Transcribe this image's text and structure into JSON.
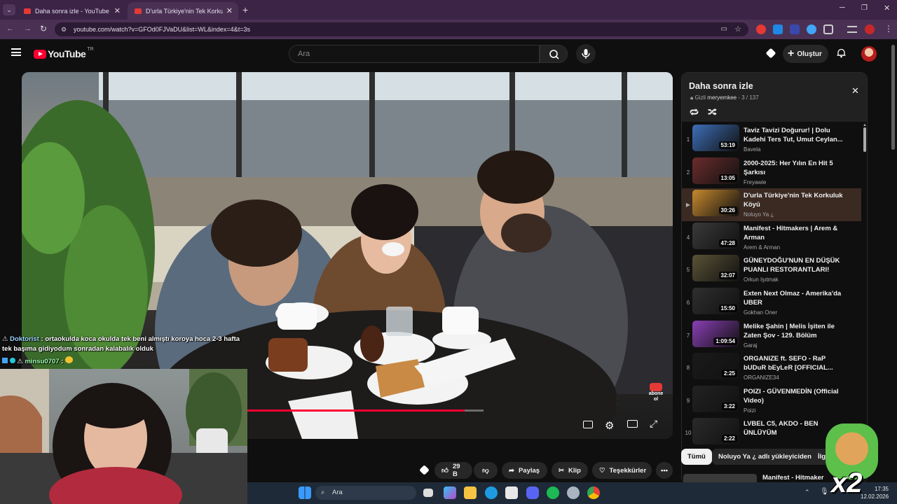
{
  "browser": {
    "tabs": [
      {
        "title": "Daha sonra izle - YouTube",
        "active": false
      },
      {
        "title": "D'urla Türkiye'nin Tek Korkuluk",
        "active": true
      }
    ],
    "url": "youtube.com/watch?v=GFOd0FJVaDU&list=WL&index=4&t=3s"
  },
  "header": {
    "logo_text": "YouTube",
    "logo_sup": "TR",
    "search_placeholder": "Ara",
    "create_label": "Oluştur"
  },
  "video": {
    "watermark": "abone ol",
    "progress_fraction": 0.92
  },
  "chat": {
    "messages": [
      {
        "user": "Doktorist",
        "text": ": ortaokulda koca okulda tek beni almıştı koroya hoca 2-3 hafta tek başıma gidiyodum sonradan kalabalık olduk"
      },
      {
        "user": "minsu0707",
        "text": ":"
      }
    ]
  },
  "actions": {
    "likes": "29 B",
    "share": "Paylaş",
    "clip": "Klip",
    "thanks": "Teşekkürler"
  },
  "playlist": {
    "title": "Daha sonra izle",
    "privacy": "Gizli",
    "owner": "meryemkee",
    "position": "3 / 137",
    "items": [
      {
        "index": "1",
        "title": "Taviz Tavizi Doğurur! | Dolu Kadehi Ters Tut, Umut Ceylan...",
        "channel": "Bavela",
        "duration": "53:19",
        "color": "#3d6fb8"
      },
      {
        "index": "2",
        "title": "2000-2025: Her Yılın En Hit 5 Şarkısı",
        "channel": "Freyawie",
        "duration": "13:05",
        "color": "#6b2c2c"
      },
      {
        "index": "▶",
        "title": "D'urla Türkiye'nin Tek Korkuluk Köyü",
        "channel": "Noluyo Ya ¿",
        "duration": "30:26",
        "color": "#c7892e"
      },
      {
        "index": "4",
        "title": "Manifest - Hitmakers | Arem & Arman",
        "channel": "Arem & Arman",
        "duration": "47:28",
        "color": "#3a3a3a"
      },
      {
        "index": "5",
        "title": "GÜNEYDOĞU'NUN EN DÜŞÜK PUANLI RESTORANTLARI!",
        "channel": "Orkun Işıtmak",
        "duration": "32:07",
        "color": "#5a5336"
      },
      {
        "index": "6",
        "title": "Exten Next Olmaz - Amerika'da UBER",
        "channel": "Gokhan Oner",
        "duration": "15:50",
        "color": "#2f2f2f"
      },
      {
        "index": "7",
        "title": "Melike Şahin | Melis İşiten ile Zaten Şov - 129. Bölüm",
        "channel": "Garaj",
        "duration": "1:09:54",
        "color": "#8a3fb5"
      },
      {
        "index": "8",
        "title": "ORGANIZE ft. SEFO - RaP bUDuR bEyLeR [OFFICIAL...",
        "channel": "ORGANIZE34",
        "duration": "2:25",
        "color": "#1a1a1a"
      },
      {
        "index": "9",
        "title": "POIZI - GÜVENMEDİN (Official Video)",
        "channel": "Poizi",
        "duration": "3:22",
        "color": "#222222"
      },
      {
        "index": "10",
        "title": "LVBEL C5, AKDO - BEN ÜNLÜYÜM",
        "channel": "",
        "duration": "2:22",
        "color": "#2a2a2a"
      }
    ]
  },
  "chips": [
    "Tümü",
    "Noluyo Ya ¿ adlı yükleyiciden",
    "İlgi"
  ],
  "related": {
    "title": "Manifest - Hitmaker"
  },
  "taskbar": {
    "search": "Ara",
    "time": "17:35",
    "date": "12.02.2026"
  },
  "overlay": {
    "multiplier": "x2"
  },
  "colors": {
    "accent": "#ff0033",
    "tab_bar": "#3b2446",
    "address_bar": "#4a3154",
    "active_row": "#3a2a22"
  }
}
